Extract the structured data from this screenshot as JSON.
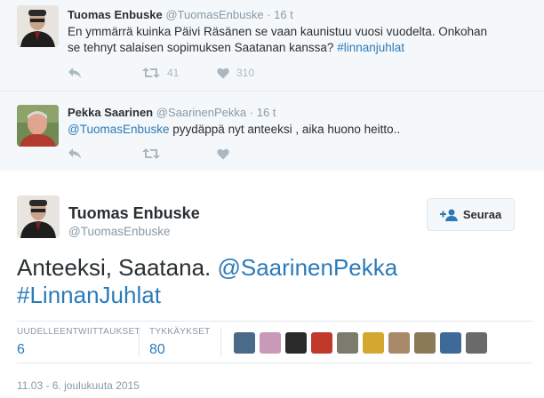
{
  "replies": [
    {
      "name": "Tuomas Enbuske",
      "handle": "@TuomasEnbuske",
      "dot": "·",
      "time": "16 t",
      "text_line1": "En ymmärrä kuinka Päivi Räsänen se vaan kaunistuu vuosi vuodelta. Onkohan",
      "text_line2": "se tehnyt salaisen sopimuksen Saatanan kanssa? ",
      "hashtag": "#linnanjuhlat",
      "retweets": "41",
      "likes": "310"
    },
    {
      "name": "Pekka Saarinen",
      "handle": "@SaarinenPekka",
      "dot": "·",
      "time": "16 t",
      "mention": "@TuomasEnbuske",
      "text": " pyydäppä nyt anteeksi , aika huono heitto..",
      "retweets": "",
      "likes": ""
    }
  ],
  "main": {
    "name": "Tuomas Enbuske",
    "handle": "@TuomasEnbuske",
    "follow_label": "Seuraa",
    "text_plain": "Anteeksi, Saatana. ",
    "mention": "@SaarinenPekka",
    "hashtag": "#LinnanJuhlat",
    "stats": {
      "retweets_label": "UUDELLEENTWIITTAUKSET",
      "retweets_value": "6",
      "likes_label": "TYKKÄYKSET",
      "likes_value": "80"
    },
    "likers_count": 10,
    "date": "11.03 - 6. joulukuuta 2015"
  },
  "colors": {
    "link": "#2b7bb9",
    "muted": "#8899a6",
    "background_thread": "#f5f8fa"
  },
  "icons": {
    "reply": "reply-icon",
    "retweet": "retweet-icon",
    "like": "heart-icon",
    "follow": "follow-person-plus-icon"
  }
}
